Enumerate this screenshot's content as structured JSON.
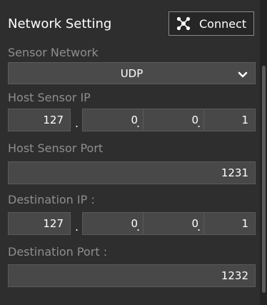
{
  "header": {
    "title": "Network Setting",
    "connect_label": "Connect",
    "connect_icon": "network-nodes-icon"
  },
  "sensor_network": {
    "label": "Sensor Network",
    "selected": "UDP",
    "icon": "chevron-down-icon"
  },
  "host_sensor_ip": {
    "label": "Host Sensor IP",
    "octets": [
      "127",
      "0",
      "0",
      "1"
    ]
  },
  "host_sensor_port": {
    "label": "Host Sensor Port",
    "value": "1231"
  },
  "destination_ip": {
    "label": "Destination IP :",
    "octets": [
      "127",
      "0",
      "0",
      "1"
    ]
  },
  "destination_port": {
    "label": "Destination Port :",
    "value": "1232"
  },
  "colors": {
    "background": "#2e2e2e",
    "field": "#484848",
    "label": "#8e8e8e",
    "text": "#ffffff"
  }
}
